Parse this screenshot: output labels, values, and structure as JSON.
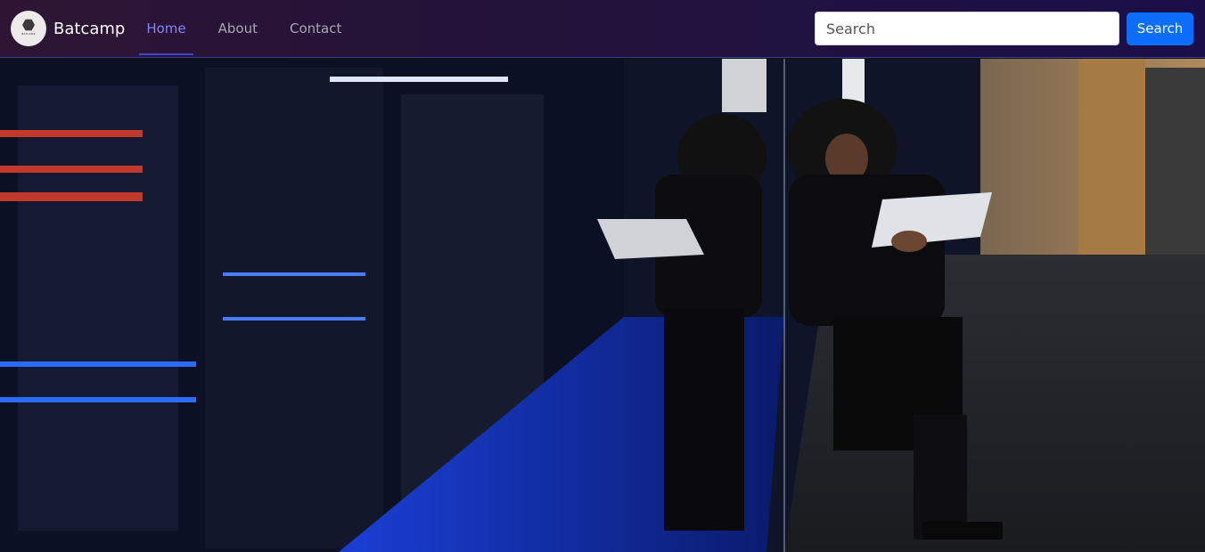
{
  "brand": {
    "name": "Batcamp",
    "logo_text": "BATCAMP"
  },
  "nav": {
    "items": [
      {
        "label": "Home",
        "active": true
      },
      {
        "label": "About",
        "active": false
      },
      {
        "label": "Contact",
        "active": false
      }
    ]
  },
  "search": {
    "placeholder": "Search",
    "button_label": "Search"
  },
  "hero": {
    "description": "photo of a woman with a laptop leaning against a glass wall in a server room corridor"
  },
  "colors": {
    "navbar_start": "#2e1533",
    "navbar_end": "#1a0f49",
    "active_link": "#7f84ff",
    "primary_button": "#0d6efd"
  }
}
